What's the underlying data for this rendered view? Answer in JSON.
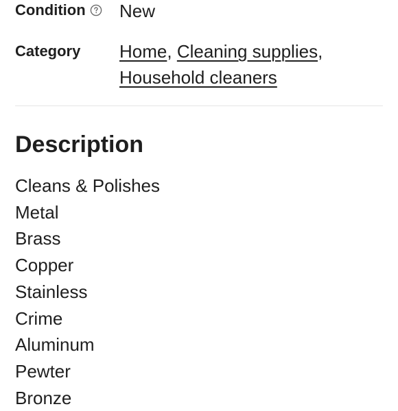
{
  "details": {
    "condition": {
      "label": "Condition",
      "icon": "help-circle-icon",
      "value": "New"
    },
    "category": {
      "label": "Category",
      "links": [
        "Home",
        "Cleaning supplies",
        "Household cleaners"
      ],
      "separator": ","
    }
  },
  "description": {
    "title": "Description",
    "lines": [
      "Cleans & Polishes",
      "Metal",
      "Brass",
      "Copper",
      "Stainless",
      "Crime",
      "Aluminum",
      "Pewter",
      "Bronze"
    ]
  }
}
